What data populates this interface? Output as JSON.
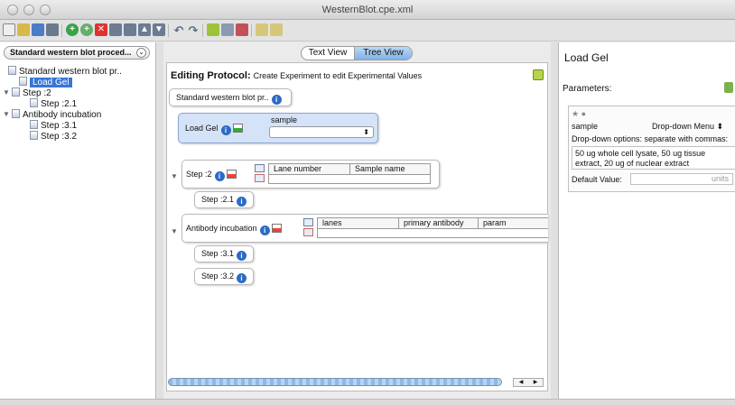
{
  "window": {
    "title": "WesternBlot.cpe.xml"
  },
  "left_panel": {
    "protocol_selector": "Standard western blot proced...",
    "tree": [
      {
        "label": "Standard western blot pr..",
        "indent": 0
      },
      {
        "label": "Load Gel",
        "indent": 1,
        "selected": true
      },
      {
        "label": "Step :2",
        "indent": 0,
        "expanded": true
      },
      {
        "label": "Step :2.1",
        "indent": 2
      },
      {
        "label": "Antibody incubation",
        "indent": 0,
        "expanded": true
      },
      {
        "label": "Step :3.1",
        "indent": 2
      },
      {
        "label": "Step :3.2",
        "indent": 2
      }
    ]
  },
  "center": {
    "tabs": {
      "text": "Text View",
      "tree": "Tree View",
      "active": "tree"
    },
    "editing_title": "Editing Protocol:",
    "editing_hint": "Create Experiment to edit Experimental Values",
    "root_step": "Standard western blot pr..",
    "load_gel": {
      "label": "Load Gel",
      "param_label": "sample",
      "select_value": ""
    },
    "step2": {
      "label": "Step :2",
      "columns": [
        "Lane number",
        "Sample name"
      ]
    },
    "step21": {
      "label": "Step :2.1"
    },
    "antibody": {
      "label": "Antibody incubation",
      "columns": [
        "lanes",
        "primary antibody",
        "param"
      ]
    },
    "step31": {
      "label": "Step :3.1"
    },
    "step32": {
      "label": "Step :3.2"
    }
  },
  "right_panel": {
    "title": "Load Gel",
    "parameters_label": "Parameters:",
    "param_name": "sample",
    "param_type": "Drop-down Menu",
    "options_label": "Drop-down options: separate with commas:",
    "options_value": "50 ug whole cell lysate, 50 ug tissue extract, 20 ug of nuclear extract",
    "default_label": "Default Value:",
    "default_placeholder": "units"
  },
  "colors": {
    "selection": "#3875d7",
    "tab_active": "#7fb2e8",
    "step_highlight": "#d4e3f7"
  }
}
